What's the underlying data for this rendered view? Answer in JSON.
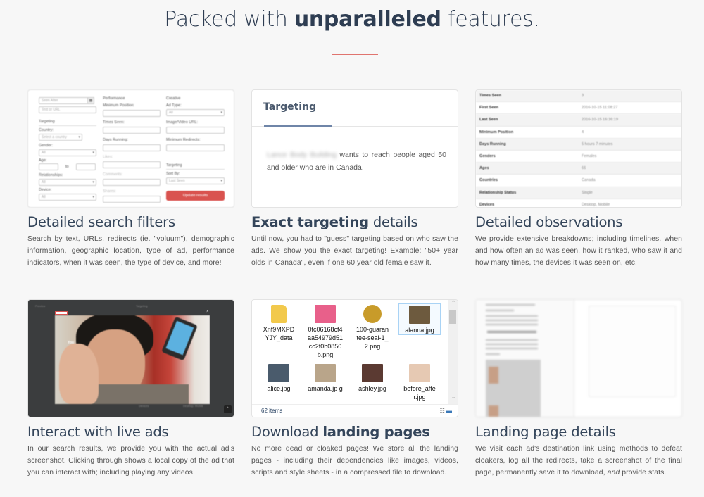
{
  "header": {
    "title_prefix": "Packed with",
    "title_bold": "unparalleled",
    "title_suffix": "features.",
    "accent_color": "#e0746f"
  },
  "features": [
    {
      "title_plain": "Detailed search filters",
      "title_bold": "",
      "title_rest": "",
      "description": "Search by text, URLs, redirects (ie. \"voluum\"), demographic information, geographic location, type of ad, performance indicators, when it was seen, the type of device, and more!",
      "screenshot": {
        "date_placeholder": "Seen After",
        "text_placeholder": "Text or URL",
        "targeting_heading": "Targeting",
        "country_label": "Country:",
        "country_value": "Select a country",
        "gender_label": "Gender:",
        "gender_value": "All",
        "age_label": "Age:",
        "age_to": "to",
        "relationship_label": "Relationships:",
        "relationship_value": "All",
        "device_label": "Device:",
        "device_value": "All",
        "performance_heading": "Performance",
        "min_position_label": "Minimum Position:",
        "times_seen_label": "Times Seen:",
        "days_running_label": "Days Running:",
        "likes_label": "Likes:",
        "comments_label": "Comments:",
        "shares_label": "Shares:",
        "creative_heading": "Creative",
        "ad_type_label": "Ad Type:",
        "ad_type_value": "All",
        "image_url_label": "Image/Video URL:",
        "min_redirects_label": "Minimum Redirects:",
        "sort_heading": "Targeting",
        "sort_label": "Sort By:",
        "sort_value": "Last Seen",
        "update_button": "Update results",
        "button_color": "#d9534f"
      }
    },
    {
      "title_plain": "",
      "title_bold": "Exact targeting",
      "title_rest": " details",
      "description": "Until now, you had to \"guess\" targeting based on who saw the ads. We show you the exact targeting! Example: \"50+ year olds in Canada\", even if one 60 year old female saw it.",
      "screenshot": {
        "heading": "Targeting",
        "advertiser_blurred": "Lance Body Building",
        "sentence": " wants to reach people aged 50 and older who are in Canada."
      }
    },
    {
      "title_plain": "Detailed observations",
      "title_bold": "",
      "title_rest": "",
      "description": "We provide extensive breakdowns; including timelines, when and how often an ad was seen, how it ranked, who saw it and how many times, the devices it was seen on, etc.",
      "screenshot": {
        "rows": [
          {
            "key": "Times Seen",
            "value": "3"
          },
          {
            "key": "First Seen",
            "value": "2016-10-15 11:08:27"
          },
          {
            "key": "Last Seen",
            "value": "2016-10-15 16:16:19"
          },
          {
            "key": "Minimum Position",
            "value": "4"
          },
          {
            "key": "Days Running",
            "value": "5 hours 7 minutes"
          },
          {
            "key": "Genders",
            "value": "Females"
          },
          {
            "key": "Ages",
            "value": "66"
          },
          {
            "key": "Countries",
            "value": "Canada"
          },
          {
            "key": "Relationship Status",
            "value": "Single"
          },
          {
            "key": "Devices",
            "value": "Desktop, Mobile"
          }
        ]
      }
    },
    {
      "title_plain": "Interact with live ads",
      "title_bold": "",
      "title_rest": "",
      "description": "In our search results, we provide you with the actual ad's screenshot. Clicking through shows a local copy of the ad that you can interact with; including playing any videos!",
      "screenshot": {
        "preview_label": "Preview",
        "targeting_label": "Targeting",
        "close_glyph": "×",
        "caption": "You",
        "devices_label": "Devices",
        "devices_value": "Desktop, Mobile",
        "scroll_top_glyph": "^"
      }
    },
    {
      "title_plain": "Download ",
      "title_bold": "landing pages",
      "title_rest": "",
      "description": "No more dead or cloaked pages! We store all the landing pages - including their dependencies like images, videos, scripts and style sheets - in a compressed file to download.",
      "screenshot": {
        "files": [
          {
            "name": "Xnf9MXPD YJY_data",
            "type": "folder"
          },
          {
            "name": "0fc06168cf4 aa54979d51 cc2f0b0850 b.png",
            "type": "image"
          },
          {
            "name": "100-guaran tee-seal-1_ 2.png",
            "type": "image"
          },
          {
            "name": "alanna.jpg",
            "type": "image",
            "selected": true
          },
          {
            "name": "alice.jpg",
            "type": "image"
          },
          {
            "name": "amanda.jp g",
            "type": "image"
          },
          {
            "name": "ashley.jpg",
            "type": "image"
          },
          {
            "name": "before_afte r.jpg",
            "type": "image"
          }
        ],
        "item_count": "62 items"
      }
    },
    {
      "title_plain": "Landing page details",
      "title_bold": "",
      "title_rest": "",
      "description_before_em": "We visit each ad's destination link using methods to defeat cloakers, log all the redirects, take a screenshot of the final page, permanently save it to download, ",
      "description_em": "and",
      "description_after_em": " provide stats."
    }
  ]
}
